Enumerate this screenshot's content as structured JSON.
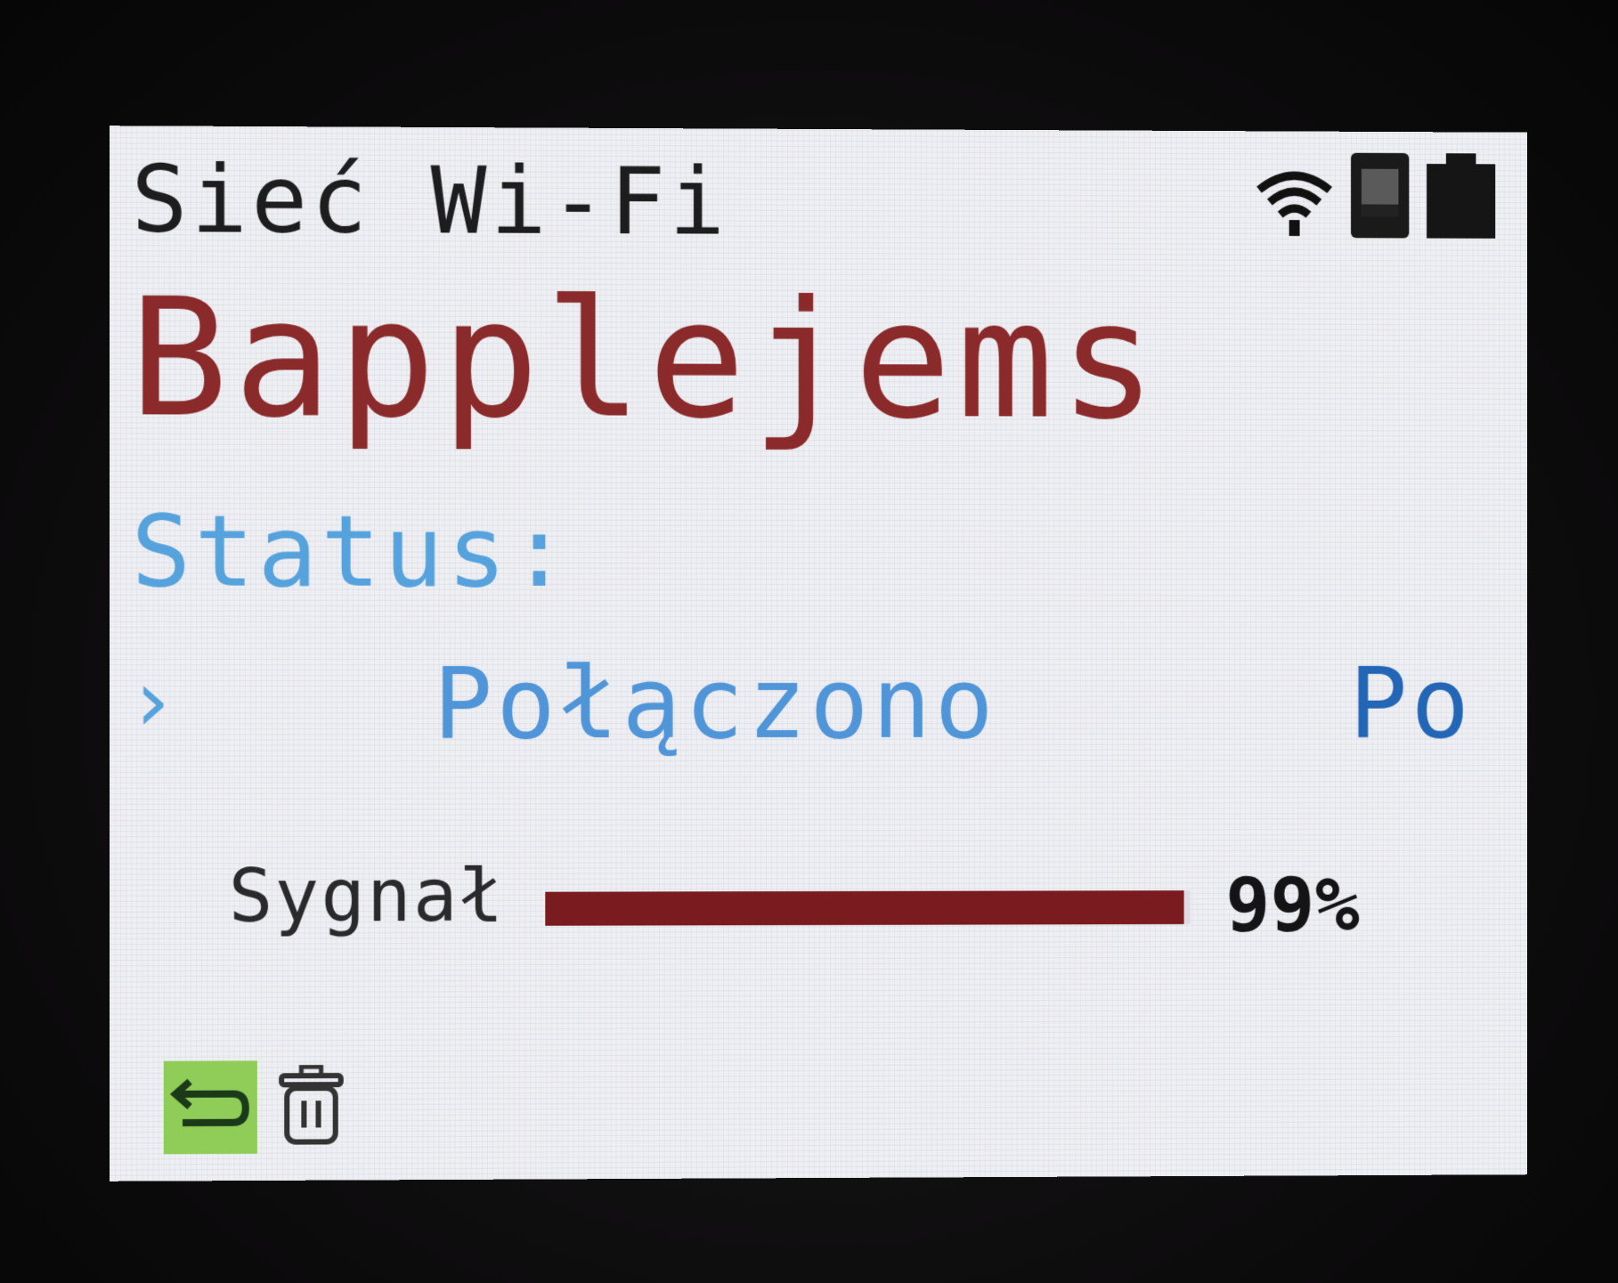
{
  "header": {
    "title": "Sieć Wi-Fi",
    "icons": [
      "wifi-icon",
      "sd-card-icon",
      "battery-icon"
    ]
  },
  "network": {
    "name": "Bapplejems"
  },
  "status": {
    "label": "Status:",
    "arrow": "›",
    "value": "Połączono",
    "overflow_text": "Po"
  },
  "signal": {
    "label": "Sygnał",
    "level": 0.99,
    "value_text": "99%"
  },
  "toolbar": {
    "buttons": [
      "back-icon",
      "trash-icon"
    ]
  },
  "colors": {
    "network_name": "#8a2a2a",
    "status": "#56a2dd",
    "signal_fill": "#7a1c1f",
    "back_button": "#8fcd58"
  }
}
